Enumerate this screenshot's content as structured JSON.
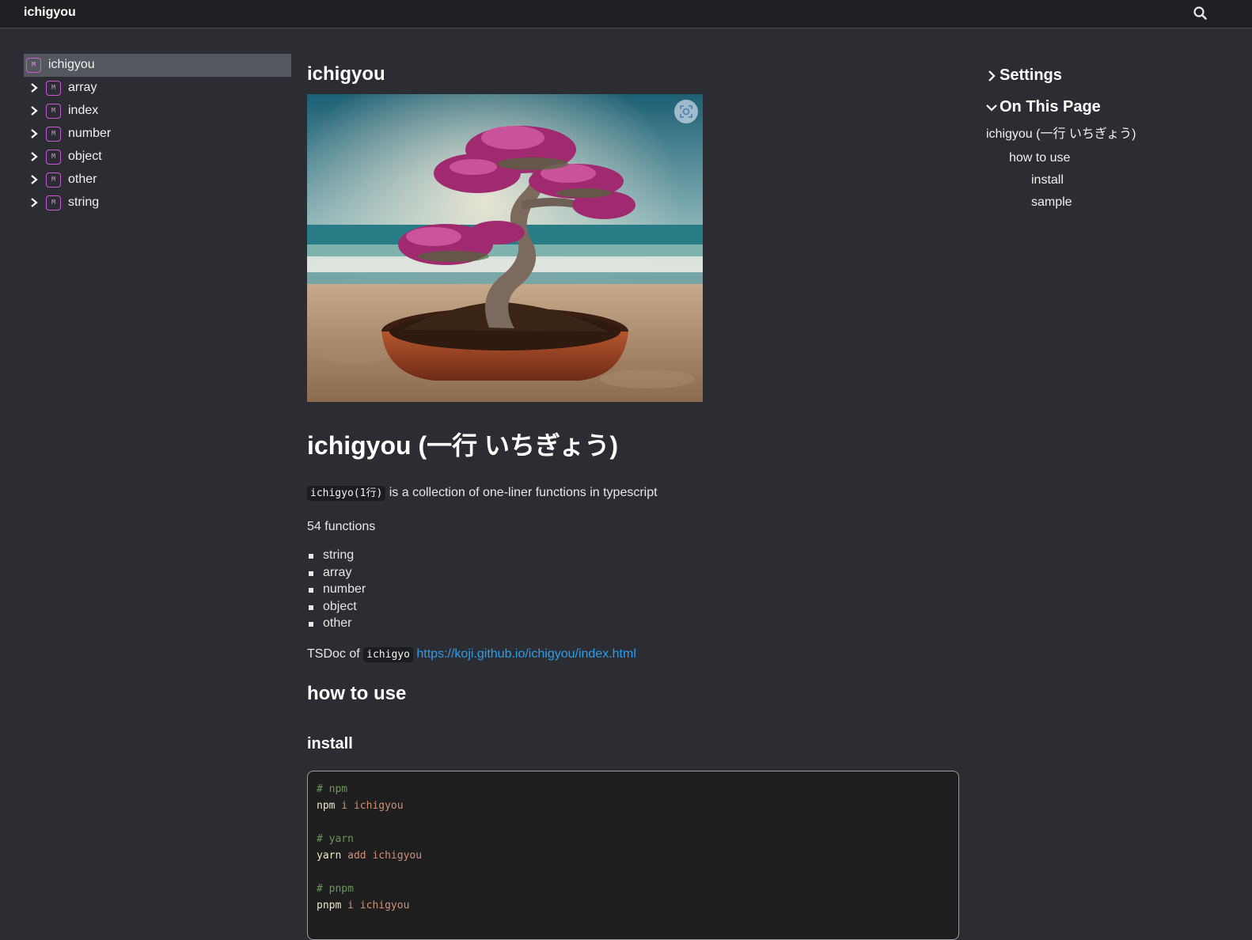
{
  "topbar": {
    "brand": "ichigyou",
    "search_icon": "search-icon"
  },
  "sidebar": {
    "items": [
      {
        "label": "ichigyou",
        "badge": "M",
        "active": true
      },
      {
        "label": "array",
        "badge": "M"
      },
      {
        "label": "index",
        "badge": "M"
      },
      {
        "label": "number",
        "badge": "M"
      },
      {
        "label": "object",
        "badge": "M"
      },
      {
        "label": "other",
        "badge": "M"
      },
      {
        "label": "string",
        "badge": "M"
      }
    ]
  },
  "main": {
    "title": "ichigyou",
    "heading": "ichigyou (一行 いちぎょう)",
    "desc_code": "ichigyo(1行)",
    "desc_text": " is a collection of one-liner functions in typescript",
    "count": "54 functions",
    "categories": [
      "string",
      "array",
      "number",
      "object",
      "other"
    ],
    "tsdoc_prefix": "TSDoc of ",
    "tsdoc_code": "ichigyo",
    "tsdoc_link": "https://koji.github.io/ichigyou/index.html",
    "how_to_use": "how to use",
    "install": "install",
    "code_lines": [
      {
        "comment": "# npm"
      },
      {
        "cmd": "npm",
        "args": " i ichigyou"
      },
      {
        "blank": ""
      },
      {
        "comment": "# yarn"
      },
      {
        "cmd": "yarn",
        "args": " add ichigyou"
      },
      {
        "blank": ""
      },
      {
        "comment": "# pnpm"
      },
      {
        "cmd": "pnpm",
        "args": " i ichigyou"
      }
    ]
  },
  "toc": {
    "settings": "Settings",
    "on_this_page": "On This Page",
    "items": {
      "top": "ichigyou (一行 いちぎょう)",
      "how_to_use": "how to use",
      "install": "install",
      "sample": "sample"
    }
  },
  "colors": {
    "accent_badge": "#c95ad6",
    "link": "#2f9ce8",
    "background": "#2b2d32"
  }
}
